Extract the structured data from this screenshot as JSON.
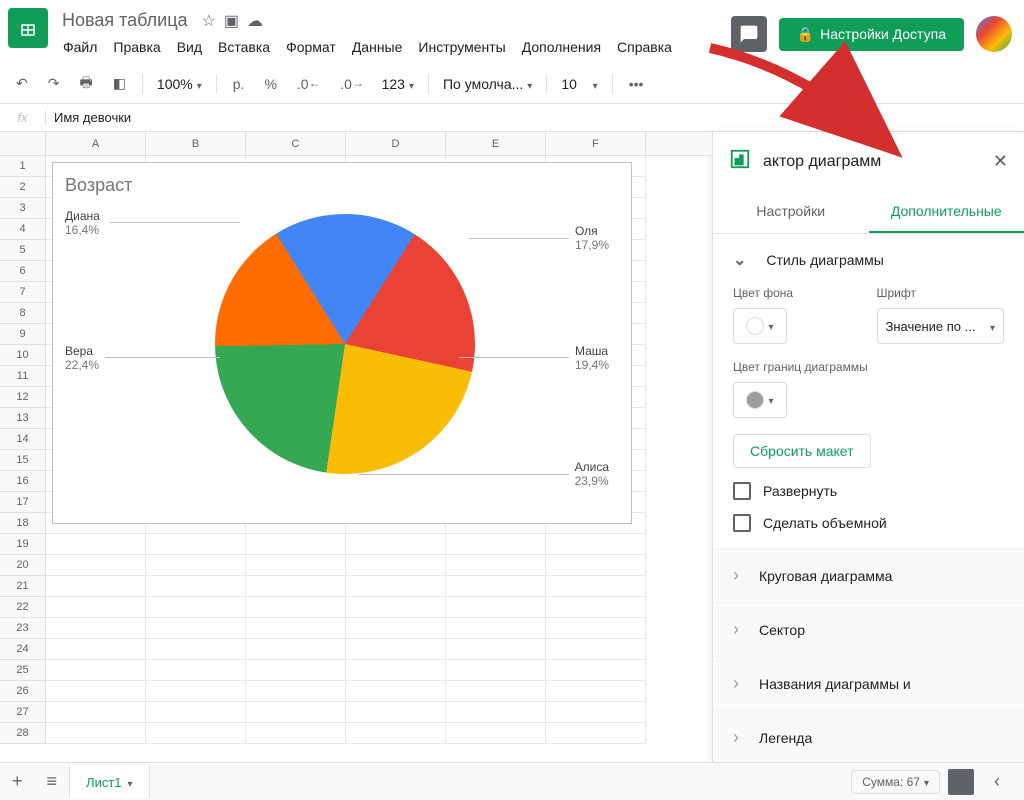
{
  "doc": {
    "title": "Новая таблица"
  },
  "menu": [
    "Файл",
    "Правка",
    "Вид",
    "Вставка",
    "Формат",
    "Данные",
    "Инструменты",
    "Дополнения",
    "Справка"
  ],
  "share": "Настройки Доступа",
  "toolbar": {
    "zoom": "100%",
    "currency": "р.",
    "percent": "%",
    "dec_dec": ".0",
    "dec_inc": ".00",
    "format": "123",
    "font": "По умолча...",
    "size": "10"
  },
  "formula": {
    "fx": "fx",
    "value": "Имя девочки"
  },
  "cols": [
    "A",
    "B",
    "C",
    "D",
    "E",
    "F"
  ],
  "chart_data": {
    "type": "pie",
    "title": "Возраст",
    "series": [
      {
        "name": "Оля",
        "value": 17.9,
        "label": "17,9%",
        "color": "#4285f4"
      },
      {
        "name": "Маша",
        "value": 19.4,
        "label": "19,4%",
        "color": "#ea4335"
      },
      {
        "name": "Алиса",
        "value": 23.9,
        "label": "23,9%",
        "color": "#fbbc05"
      },
      {
        "name": "Вера",
        "value": 22.4,
        "label": "22,4%",
        "color": "#34a853"
      },
      {
        "name": "Диана",
        "value": 16.4,
        "label": "16,4%",
        "color": "#ff6d00"
      }
    ]
  },
  "panel": {
    "title": "актор диаграмм",
    "full_title": "Редактор диаграмм",
    "tabs": {
      "setup": "Настройки",
      "customize": "Дополнительные"
    },
    "style": {
      "header": "Стиль диаграммы",
      "bg": "Цвет фона",
      "font": "Шрифт",
      "font_value": "Значение по ...",
      "border": "Цвет границ диаграммы",
      "reset": "Сбросить макет",
      "maximize": "Развернуть",
      "threeD": "Сделать объемной"
    },
    "sections": [
      "Круговая диаграмма",
      "Сектор",
      "Названия диаграммы и",
      "Легенда"
    ]
  },
  "sheet": {
    "name": "Лист1",
    "sum": "Сумма: 67"
  }
}
